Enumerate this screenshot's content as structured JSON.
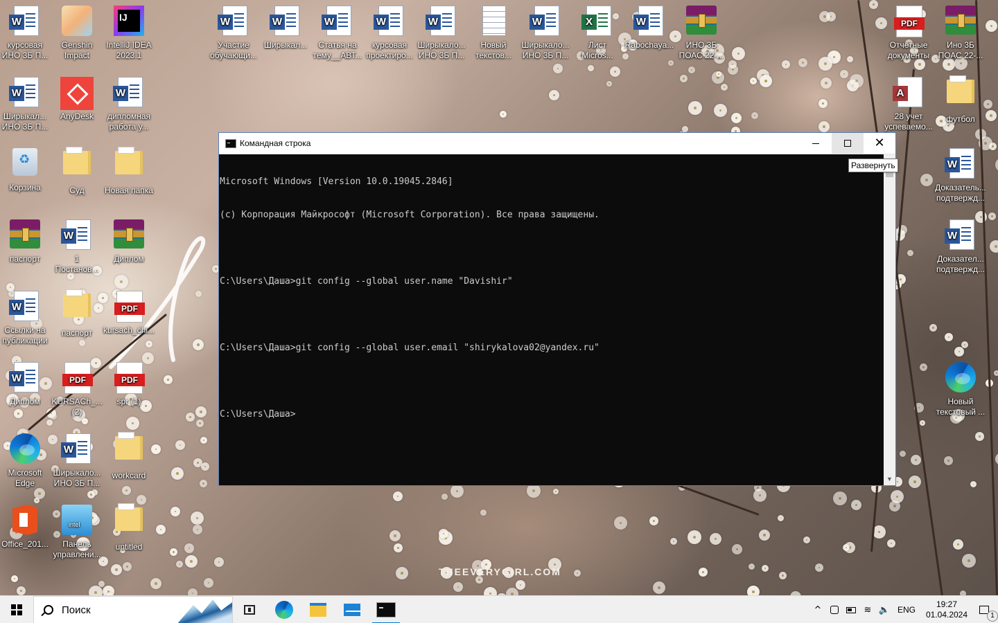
{
  "desktop": {
    "wallpaper_caption": "THEEVERYGIRL.COM",
    "icons_left": [
      {
        "label": "курсовая\nИНО 3Б П...",
        "icon": "word-doc-icon"
      },
      {
        "label": "Genshin\nImpact",
        "icon": "genshin-icon"
      },
      {
        "label": "IntelliJ IDEA\n2023.1",
        "icon": "intellij-idea-icon"
      },
      {
        "label": "Ширыкал...\nИНО 3Б П...",
        "icon": "word-doc-icon"
      },
      {
        "label": "AnyDesk",
        "icon": "anydesk-icon"
      },
      {
        "label": "дипломная\nработа у...",
        "icon": "word-doc-icon"
      },
      {
        "label": "Корзина",
        "icon": "recycle-bin-icon"
      },
      {
        "label": "Суд",
        "icon": "folder-icon"
      },
      {
        "label": "Новая папка",
        "icon": "folder-icon"
      },
      {
        "label": "паспорт",
        "icon": "winrar-archive-icon"
      },
      {
        "label": "1\nПостанов...",
        "icon": "word-doc-icon"
      },
      {
        "label": "Диплом",
        "icon": "winrar-archive-icon"
      },
      {
        "label": "Ссылки на\nпубликации",
        "icon": "word-doc-icon"
      },
      {
        "label": "паспорт",
        "icon": "folder-icon"
      },
      {
        "label": "kursach_chi...",
        "icon": "pdf-icon"
      },
      {
        "label": "Диплом",
        "icon": "word-doc-icon"
      },
      {
        "label": "KURSACh_...\n(2)",
        "icon": "pdf-icon"
      },
      {
        "label": "spr (1)",
        "icon": "pdf-icon"
      },
      {
        "label": "Microsoft\nEdge",
        "icon": "edge-icon"
      },
      {
        "label": "Ширыкало...\nИНО 3Б П...",
        "icon": "word-doc-icon"
      },
      {
        "label": "workcard",
        "icon": "folder-icon"
      },
      {
        "label": "Office_201...",
        "icon": "office-icon"
      },
      {
        "label": "Панель\nуправлени...",
        "icon": "intel-control-panel-icon"
      },
      {
        "label": "untitled",
        "icon": "folder-icon"
      }
    ],
    "icons_top": [
      {
        "label": "Участие\nобучающи...",
        "icon": "word-doc-icon"
      },
      {
        "label": "Ширыкал...",
        "icon": "word-doc-icon"
      },
      {
        "label": "Статья на\nтему__АВТ...",
        "icon": "word-doc-icon"
      },
      {
        "label": "курсовая\nпроектиро...",
        "icon": "word-doc-icon"
      },
      {
        "label": "Ширыкало...\nИНО 3Б П...",
        "icon": "word-doc-icon"
      },
      {
        "label": "Новый\nтекстов...",
        "icon": "text-doc-icon"
      },
      {
        "label": "Ширыкало...\nИНО 3Б П...",
        "icon": "word-doc-icon"
      },
      {
        "label": "Лист\nMicros...",
        "icon": "excel-doc-icon"
      },
      {
        "label": "Rabochaya...",
        "icon": "word-doc-icon"
      },
      {
        "label": "ИНО 3Б\nПОАС 22-...",
        "icon": "winrar-archive-icon"
      }
    ],
    "icons_right": [
      {
        "label": "Отчетные\nдокументы",
        "icon": "pdf-icon"
      },
      {
        "label": "Ино 3Б\nПОАС 22-...",
        "icon": "winrar-archive-icon"
      },
      {
        "label": "28 учет\nуспеваемо...",
        "icon": "access-doc-icon"
      },
      {
        "label": "футбол",
        "icon": "folder-icon"
      },
      {
        "label": "Доказатель...\nподтвержд...",
        "icon": "word-doc-icon"
      },
      {
        "label": "Доказател...\nподтвержд...",
        "icon": "word-doc-icon"
      },
      {
        "label": "Новый\nтекстовый ...",
        "icon": "edge-icon"
      }
    ]
  },
  "cmd_window": {
    "title": "Командная строка",
    "lines": [
      "Microsoft Windows [Version 10.0.19045.2846]",
      "(c) Корпорация Майкрософт (Microsoft Corporation). Все права защищены.",
      "",
      "C:\\Users\\Даша>git config --global user.name \"Davishir\"",
      "",
      "C:\\Users\\Даша>git config --global user.email \"shirykalova02@yandex.ru\"",
      "",
      "C:\\Users\\Даша>"
    ],
    "tooltip": "Развернуть",
    "scroll_up_glyph": "▲",
    "scroll_down_glyph": "▼",
    "close_glyph": "✕"
  },
  "taskbar": {
    "search_placeholder": "Поиск",
    "apps": [
      {
        "name": "task-view",
        "icon": "task-view-icon",
        "active": false
      },
      {
        "name": "edge",
        "icon": "edge-icon",
        "active": false
      },
      {
        "name": "file-explorer",
        "icon": "folder-icon",
        "active": false
      },
      {
        "name": "mail",
        "icon": "mail-icon",
        "active": false
      },
      {
        "name": "command-prompt",
        "icon": "cmd-icon",
        "active": true
      }
    ],
    "tray": {
      "chevron": "^",
      "wifi_glyph": "≋",
      "volume_glyph": "🔈",
      "language": "ENG",
      "time": "19:27",
      "date": "01.04.2024",
      "notification_count": "1"
    }
  }
}
